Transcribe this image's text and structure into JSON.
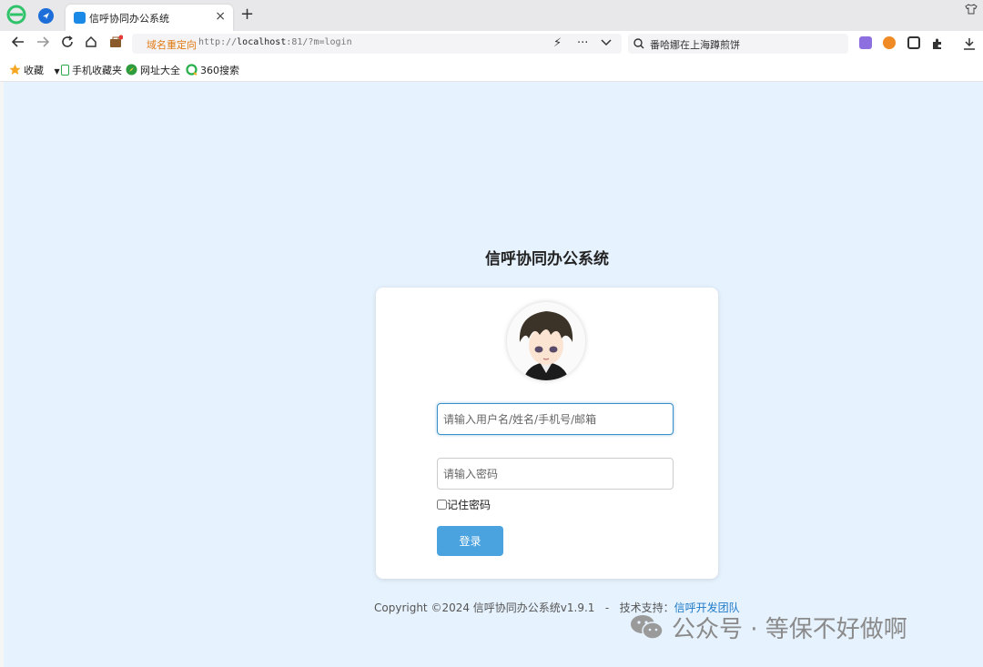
{
  "tab": {
    "title": "信呼协同办公系统",
    "close_icon": "×",
    "new_tab_icon": "+"
  },
  "omnibox": {
    "redirect_label": "域名重定向",
    "url_prefix": "http://",
    "url_host": "localhost",
    "url_rest": ":81/?m=login"
  },
  "search": {
    "text": "番哈娜在上海蹲煎饼"
  },
  "bookmarks": [
    {
      "label": "收藏",
      "icon": "star-icon"
    },
    {
      "label": "手机收藏夹",
      "icon": "phone-icon"
    },
    {
      "label": "网址大全",
      "icon": "compass-icon"
    },
    {
      "label": "360搜索",
      "icon": "search-360-icon"
    }
  ],
  "login": {
    "title": "信呼协同办公系统",
    "username_placeholder": "请输入用户名/姓名/手机号/邮箱",
    "password_placeholder": "请输入密码",
    "remember_label": "记住密码",
    "login_button": "登录"
  },
  "footer": {
    "copyright": "Copyright ©2024 信呼协同办公系统v1.9.1   -   技术支持：",
    "support_link": "信呼开发团队"
  },
  "watermark": {
    "text": "公众号 · 等保不好做啊"
  },
  "colors": {
    "page_bg": "#e6f2fd",
    "primary": "#4aa3df",
    "redirect": "#e07a12",
    "link": "#1e7ac8"
  }
}
